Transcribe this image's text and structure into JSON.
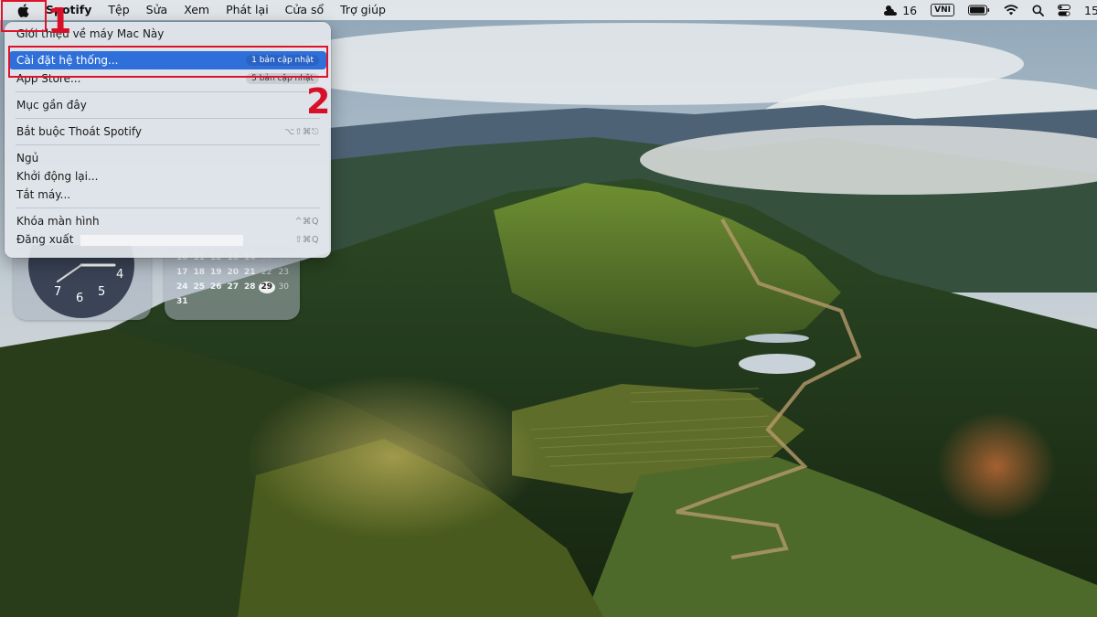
{
  "menubar": {
    "apple_icon": "apple-logo-icon",
    "items": [
      "Spotify",
      "Tệp",
      "Sửa",
      "Xem",
      "Phát lại",
      "Cửa sổ",
      "Trợ giúp"
    ],
    "status": {
      "weather_temp": "16",
      "input_method": "VNI",
      "clock_fragment": "15"
    }
  },
  "apple_menu": {
    "about": "Giới thiệu về máy Mac Này",
    "system_settings": {
      "label": "Cài đặt hệ thống...",
      "badge": "1 bản cập nhật"
    },
    "app_store": {
      "label": "App Store...",
      "badge": "5 bản cập nhật"
    },
    "recent": "Mục gần đây",
    "force_quit": {
      "label": "Bắt buộc Thoát Spotify",
      "shortcut": "⌥⇧⌘⎋"
    },
    "sleep": "Ngủ",
    "restart": "Khởi động lại...",
    "shutdown": "Tắt máy...",
    "lock": {
      "label": "Khóa màn hình",
      "shortcut": "^⌘Q"
    },
    "logout": {
      "label": "Đăng xuất",
      "shortcut": "⇧⌘Q"
    }
  },
  "widgets": {
    "clock_numbers": [
      "7",
      "6",
      "5",
      "4"
    ],
    "calendar_rows": [
      [
        "10",
        "11",
        "12",
        "13",
        "14",
        "15",
        "16"
      ],
      [
        "17",
        "18",
        "19",
        "20",
        "21",
        "22",
        "23"
      ],
      [
        "24",
        "25",
        "26",
        "27",
        "28",
        "29",
        "30"
      ],
      [
        "31"
      ]
    ],
    "calendar_today": "29"
  },
  "annotations": {
    "step1": "1",
    "step2": "2"
  },
  "colors": {
    "highlight": "#2f6fd9",
    "annotation_red": "#e0122b"
  }
}
